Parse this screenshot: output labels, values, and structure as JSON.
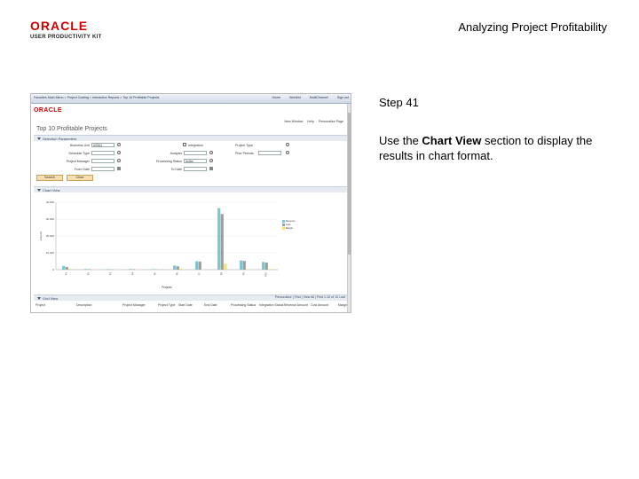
{
  "header": {
    "logo_line1": "ORACLE",
    "logo_line2": "USER PRODUCTIVITY KIT",
    "title": "Analyzing Project Profitability"
  },
  "step": {
    "number": "Step 41",
    "instruction_prefix": "Use the ",
    "instruction_bold": "Chart View",
    "instruction_suffix": " section to display the results in chart format."
  },
  "screenshot": {
    "breadcrumb": "Favorites   Main Menu   > Project Costing > Interactive Reports > Top 10 Profitable Projects",
    "nav": [
      "Home",
      "Worklist",
      "MultiChannel",
      "Sign out"
    ],
    "logo": "ORACLE",
    "toplinks": [
      "New Window",
      "Help",
      "Personalize Page"
    ],
    "page_title": "Top 10 Profitable Projects",
    "section_criteria": "Selection Parameters",
    "fields": {
      "business_unit_label": "Business Unit",
      "business_unit_value": "US004",
      "integration_label": "Integration",
      "project_type_label": "Project Type",
      "scheduled_label": "Schedule Type",
      "analysis_label": "Analysis",
      "prior_label": "Prior Periods",
      "manager_label": "Project Manager",
      "status_label": "Processing Status",
      "status_value": "Active",
      "from_label": "From Date",
      "to_label": "To Date"
    },
    "buttons": {
      "search": "Search",
      "clear": "Clear"
    },
    "section_chart": "Chart View",
    "section_grid": "Grid View",
    "grid_tools": "Personalize | Find | View All | First 1-10 of 10 Last",
    "grid_columns": [
      "Project",
      "Description",
      "Project Manager",
      "Project Type",
      "Start Date",
      "End Date",
      "Processing Status",
      "Integration Status",
      "Revenue Amount",
      "Cost Amount",
      "Margin"
    ],
    "legend": [
      {
        "label": "Revenue",
        "color": "#7cc7cf"
      },
      {
        "label": "Cost",
        "color": "#9e9e9e"
      },
      {
        "label": "Margin",
        "color": "#f0e27a"
      }
    ]
  },
  "chart_data": {
    "type": "bar",
    "ylabel": "Amount",
    "xlabel": "Projects",
    "ylim": [
      0,
      40000
    ],
    "yticks": [
      "40,000",
      "30,000",
      "20,000",
      "10,000",
      "0"
    ],
    "categories": [
      "P1",
      "P2",
      "P3",
      "P4",
      "P5",
      "P6",
      "P7",
      "P8",
      "P9",
      "P10"
    ],
    "series": [
      {
        "name": "Revenue",
        "values": [
          2200,
          400,
          300,
          400,
          300,
          2500,
          5000,
          36500,
          5500,
          4600
        ]
      },
      {
        "name": "Cost",
        "values": [
          1600,
          300,
          200,
          300,
          200,
          2000,
          4800,
          33000,
          5200,
          4200
        ]
      },
      {
        "name": "Margin",
        "values": [
          600,
          100,
          100,
          100,
          100,
          500,
          200,
          3500,
          300,
          400
        ]
      }
    ]
  }
}
